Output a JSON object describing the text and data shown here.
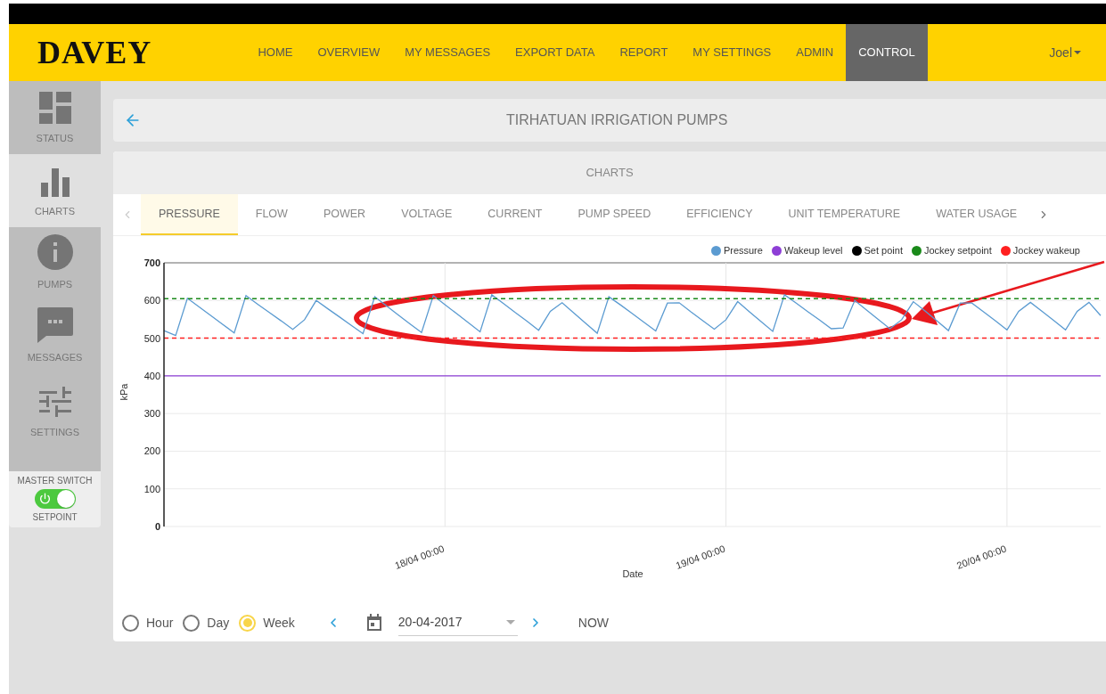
{
  "header": {
    "logo": "DAVEY",
    "nav": [
      {
        "label": "HOME",
        "selected": false
      },
      {
        "label": "OVERVIEW",
        "selected": false
      },
      {
        "label": "MY MESSAGES",
        "selected": false
      },
      {
        "label": "EXPORT DATA",
        "selected": false
      },
      {
        "label": "REPORT",
        "selected": false
      },
      {
        "label": "MY SETTINGS",
        "selected": false
      },
      {
        "label": "ADMIN",
        "selected": false
      },
      {
        "label": "CONTROL",
        "selected": true
      }
    ],
    "user": "Joel"
  },
  "sidebar": {
    "items": [
      {
        "label": "STATUS",
        "kind": "status",
        "selected": false
      },
      {
        "label": "CHARTS",
        "kind": "charts",
        "selected": true
      },
      {
        "label": "PUMPS",
        "kind": "pumps",
        "selected": false
      },
      {
        "label": "MESSAGES",
        "kind": "messages",
        "selected": false
      },
      {
        "label": "SETTINGS",
        "kind": "settings",
        "selected": false
      }
    ],
    "master_switch": {
      "label": "MASTER SWITCH",
      "on": true,
      "caption": "SETPOINT"
    }
  },
  "page_title": "TIRHATUAN IRRIGATION PUMPS",
  "charts_panel": {
    "title": "CHARTS",
    "tabs": [
      {
        "label": "PRESSURE",
        "selected": true
      },
      {
        "label": "FLOW",
        "selected": false
      },
      {
        "label": "POWER",
        "selected": false
      },
      {
        "label": "VOLTAGE",
        "selected": false
      },
      {
        "label": "CURRENT",
        "selected": false
      },
      {
        "label": "PUMP SPEED",
        "selected": false
      },
      {
        "label": "EFFICIENCY",
        "selected": false
      },
      {
        "label": "UNIT TEMPERATURE",
        "selected": false
      },
      {
        "label": "WATER USAGE",
        "selected": false
      }
    ],
    "chart_data": {
      "type": "line",
      "xlabel": "Date",
      "ylabel": "kPa",
      "categories": [
        null,
        null,
        null,
        null,
        null,
        null,
        null,
        null,
        null,
        null,
        null,
        null,
        null,
        null,
        null,
        null,
        null,
        null,
        null,
        null,
        null,
        null,
        null,
        null,
        "18/04 00:00",
        null,
        null,
        null,
        null,
        null,
        null,
        null,
        null,
        null,
        null,
        null,
        null,
        null,
        null,
        null,
        null,
        null,
        null,
        null,
        null,
        null,
        null,
        null,
        "19/04 00:00",
        null,
        null,
        null,
        null,
        null,
        null,
        null,
        null,
        null,
        null,
        null,
        null,
        null,
        null,
        null,
        null,
        null,
        null,
        null,
        null,
        null,
        null,
        null,
        "20/04 00:00",
        null,
        null,
        null,
        null,
        null,
        null,
        null,
        null
      ],
      "ylim": [
        0,
        700
      ],
      "grid": true,
      "legend": "top-right",
      "yticks": [
        0,
        100,
        200,
        300,
        400,
        500,
        600,
        700
      ],
      "series": [
        {
          "name": "Pressure",
          "color": "#5b9bd1",
          "line_style": "solid",
          "values": [
            520,
            507,
            606,
            583,
            560,
            537,
            514,
            613,
            590,
            568,
            546,
            523,
            549,
            600,
            578,
            556,
            534,
            512,
            610,
            586,
            562,
            538,
            515,
            613,
            589,
            565,
            541,
            517,
            615,
            592,
            568,
            545,
            521,
            571,
            594,
            567,
            540,
            513,
            610,
            588,
            565,
            542,
            519,
            593,
            594,
            570,
            547,
            524,
            549,
            597,
            570,
            544,
            518,
            615,
            593,
            570,
            548,
            525,
            527,
            600,
            575,
            550,
            525,
            549,
            597,
            572,
            546,
            520,
            593,
            593,
            570,
            546,
            522,
            571,
            595,
            571,
            547,
            522,
            571,
            595,
            560
          ]
        },
        {
          "name": "Wakeup level",
          "color": "#8e3fd6",
          "line_style": "solid",
          "values": [
            400,
            400,
            400,
            400,
            400,
            400,
            400,
            400,
            400,
            400,
            400,
            400,
            400,
            400,
            400,
            400,
            400,
            400,
            400,
            400,
            400,
            400,
            400,
            400,
            400,
            400,
            400,
            400,
            400,
            400,
            400,
            400,
            400,
            400,
            400,
            400,
            400,
            400,
            400,
            400,
            400,
            400,
            400,
            400,
            400,
            400,
            400,
            400,
            400,
            400,
            400,
            400,
            400,
            400,
            400,
            400,
            400,
            400,
            400,
            400,
            400,
            400,
            400,
            400,
            400,
            400,
            400,
            400,
            400,
            400,
            400,
            400,
            400,
            400,
            400,
            400,
            400,
            400,
            400,
            400,
            400
          ]
        },
        {
          "name": "Set point",
          "color": "#000000",
          "values": [
            null,
            null,
            null,
            null,
            null,
            null,
            null,
            null,
            null,
            null,
            null,
            null,
            null,
            null,
            null,
            null,
            null,
            null,
            null,
            null,
            null,
            null,
            null,
            null,
            null,
            null,
            null,
            null,
            null,
            null,
            null,
            null,
            null,
            null,
            null,
            null,
            null,
            null,
            null,
            null,
            null,
            null,
            null,
            null,
            null,
            null,
            null,
            null,
            null,
            null,
            null,
            null,
            null,
            null,
            null,
            null,
            null,
            null,
            null,
            null,
            null,
            null,
            null,
            null,
            null,
            null,
            null,
            null,
            null,
            null,
            null,
            null,
            null,
            null,
            null,
            null,
            null,
            null,
            null,
            null,
            null
          ]
        },
        {
          "name": "Jockey setpoint",
          "color": "#1a8a1a",
          "line_style": "dashed",
          "values": [
            605,
            605,
            605,
            605,
            605,
            605,
            605,
            605,
            605,
            605,
            605,
            605,
            605,
            605,
            605,
            605,
            605,
            605,
            605,
            605,
            605,
            605,
            605,
            605,
            605,
            605,
            605,
            605,
            605,
            605,
            605,
            605,
            605,
            605,
            605,
            605,
            605,
            605,
            605,
            605,
            605,
            605,
            605,
            605,
            605,
            605,
            605,
            605,
            605,
            605,
            605,
            605,
            605,
            605,
            605,
            605,
            605,
            605,
            605,
            605,
            605,
            605,
            605,
            605,
            605,
            605,
            605,
            605,
            605,
            605,
            605,
            605,
            605,
            605,
            605,
            605,
            605,
            605,
            605,
            605,
            605
          ]
        },
        {
          "name": "Jockey wakeup",
          "color": "#ff2020",
          "line_style": "dashed",
          "values": [
            500,
            500,
            500,
            500,
            500,
            500,
            500,
            500,
            500,
            500,
            500,
            500,
            500,
            500,
            500,
            500,
            500,
            500,
            500,
            500,
            500,
            500,
            500,
            500,
            500,
            500,
            500,
            500,
            500,
            500,
            500,
            500,
            500,
            500,
            500,
            500,
            500,
            500,
            500,
            500,
            500,
            500,
            500,
            500,
            500,
            500,
            500,
            500,
            500,
            500,
            500,
            500,
            500,
            500,
            500,
            500,
            500,
            500,
            500,
            500,
            500,
            500,
            500,
            500,
            500,
            500,
            500,
            500,
            500,
            500,
            500,
            500,
            500,
            500,
            500,
            500,
            500,
            500,
            500,
            500,
            500
          ]
        }
      ]
    },
    "range_options": [
      {
        "label": "Hour",
        "selected": false
      },
      {
        "label": "Day",
        "selected": false
      },
      {
        "label": "Week",
        "selected": true
      }
    ],
    "date": "20-04-2017",
    "now_button": "NOW"
  }
}
